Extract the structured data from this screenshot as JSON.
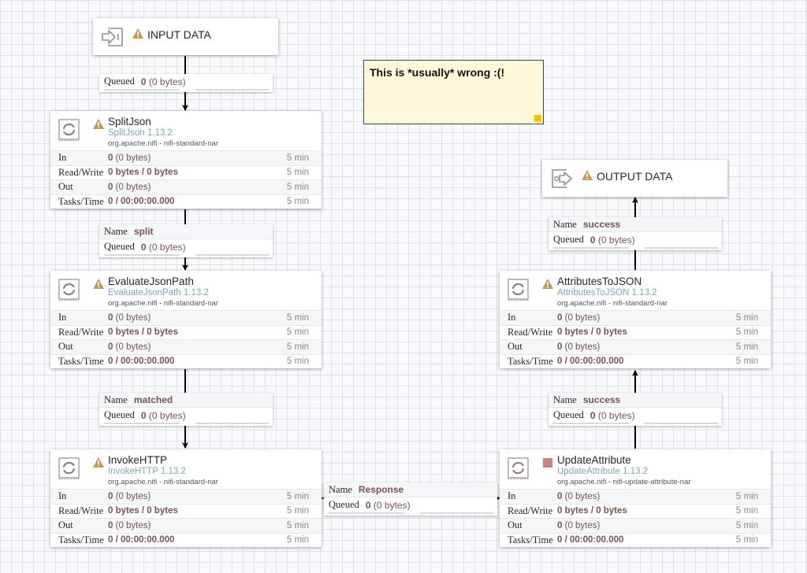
{
  "canvas": {
    "grid_color": "#dde2e6",
    "background": "#f9fafb"
  },
  "colors": {
    "warning": "#c59a52",
    "stopped": "#cf8080",
    "value_text": "#775351",
    "type_text": "#7da7b8",
    "label_bg": "#fff7d7",
    "label_handle": "#f5c400"
  },
  "input_port": {
    "name": "INPUT DATA",
    "icon": "input-port-icon",
    "status_icon": "warning-icon"
  },
  "output_port": {
    "name": "OUTPUT DATA",
    "icon": "output-port-icon",
    "status_icon": "warning-icon"
  },
  "label": {
    "text": "This is *usually* wrong :(!"
  },
  "stat_labels": {
    "in": "In",
    "read_write": "Read/Write",
    "out": "Out",
    "tasks_time": "Tasks/Time"
  },
  "processors": [
    {
      "name": "SplitJson",
      "type": "SplitJson 1.13.2",
      "bundle": "org.apache.nifi - nifi-standard-nar",
      "status": "warning",
      "in_count": "0",
      "in_size": "(0 bytes)",
      "in_time": "5 min",
      "rw": "0 bytes / 0 bytes",
      "rw_time": "5 min",
      "out_count": "0",
      "out_size": "(0 bytes)",
      "out_time": "5 min",
      "tasks": "0 / 00:00:00.000",
      "tasks_time": "5 min"
    },
    {
      "name": "EvaluateJsonPath",
      "type": "EvaluateJsonPath 1.13.2",
      "bundle": "org.apache.nifi - nifi-standard-nar",
      "status": "warning",
      "in_count": "0",
      "in_size": "(0 bytes)",
      "in_time": "5 min",
      "rw": "0 bytes / 0 bytes",
      "rw_time": "5 min",
      "out_count": "0",
      "out_size": "(0 bytes)",
      "out_time": "5 min",
      "tasks": "0 / 00:00:00.000",
      "tasks_time": "5 min"
    },
    {
      "name": "InvokeHTTP",
      "type": "InvokeHTTP 1.13.2",
      "bundle": "org.apache.nifi - nifi-standard-nar",
      "status": "warning",
      "in_count": "0",
      "in_size": "(0 bytes)",
      "in_time": "5 min",
      "rw": "0 bytes / 0 bytes",
      "rw_time": "5 min",
      "out_count": "0",
      "out_size": "(0 bytes)",
      "out_time": "5 min",
      "tasks": "0 / 00:00:00.000",
      "tasks_time": "5 min"
    },
    {
      "name": "AttributesToJSON",
      "type": "AttributesToJSON 1.13.2",
      "bundle": "org.apache.nifi - nifi-standard-nar",
      "status": "warning",
      "in_count": "0",
      "in_size": "(0 bytes)",
      "in_time": "5 min",
      "rw": "0 bytes / 0 bytes",
      "rw_time": "5 min",
      "out_count": "0",
      "out_size": "(0 bytes)",
      "out_time": "5 min",
      "tasks": "0 / 00:00:00.000",
      "tasks_time": "5 min"
    },
    {
      "name": "UpdateAttribute",
      "type": "UpdateAttribute 1.13.2",
      "bundle": "org.apache.nifi - nifi-update-attribute-nar",
      "status": "stopped",
      "in_count": "0",
      "in_size": "(0 bytes)",
      "in_time": "5 min",
      "rw": "0 bytes / 0 bytes",
      "rw_time": "5 min",
      "out_count": "0",
      "out_size": "(0 bytes)",
      "out_time": "5 min",
      "tasks": "0 / 00:00:00.000",
      "tasks_time": "5 min"
    }
  ],
  "connection_labels": {
    "name": "Name",
    "queued": "Queued"
  },
  "connections": [
    {
      "name": null,
      "queued_count": "0",
      "queued_size": "(0 bytes)"
    },
    {
      "name": "split",
      "queued_count": "0",
      "queued_size": "(0 bytes)"
    },
    {
      "name": "matched",
      "queued_count": "0",
      "queued_size": "(0 bytes)"
    },
    {
      "name": "Response",
      "queued_count": "0",
      "queued_size": "(0 bytes)"
    },
    {
      "name": "success",
      "queued_count": "0",
      "queued_size": "(0 bytes)"
    },
    {
      "name": "success",
      "queued_count": "0",
      "queued_size": "(0 bytes)"
    }
  ]
}
